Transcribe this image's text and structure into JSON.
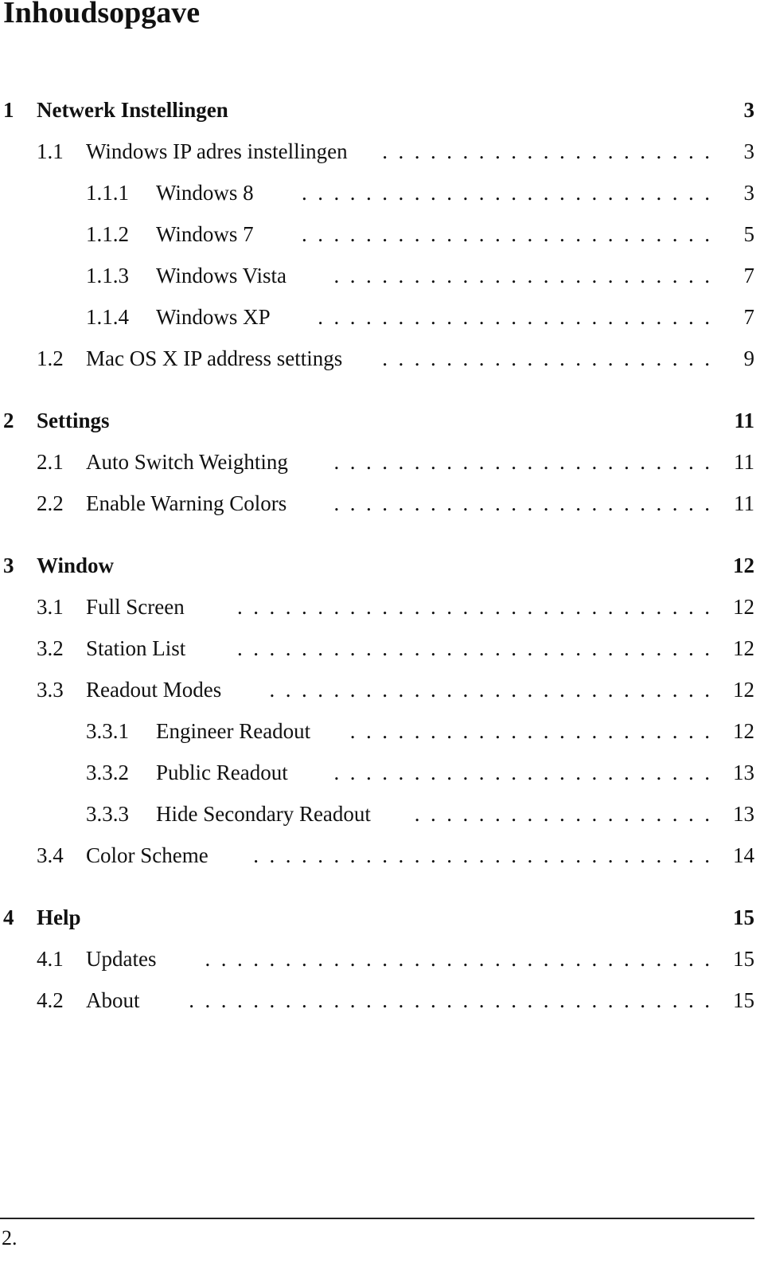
{
  "title": "Inhoudsopgave",
  "toc": [
    {
      "level": 0,
      "num": "1",
      "label": "Netwerk Instellingen",
      "page": "3",
      "gap": false
    },
    {
      "level": 1,
      "num": "1.1",
      "label": "Windows IP adres instellingen",
      "page": "3"
    },
    {
      "level": 2,
      "num": "1.1.1",
      "label": "Windows 8",
      "page": "3"
    },
    {
      "level": 2,
      "num": "1.1.2",
      "label": "Windows 7",
      "page": "5"
    },
    {
      "level": 2,
      "num": "1.1.3",
      "label": "Windows Vista",
      "page": "7"
    },
    {
      "level": 2,
      "num": "1.1.4",
      "label": "Windows XP",
      "page": "7"
    },
    {
      "level": 1,
      "num": "1.2",
      "label": "Mac OS X IP address settings",
      "page": "9"
    },
    {
      "level": 0,
      "num": "2",
      "label": "Settings",
      "page": "11",
      "gap": true
    },
    {
      "level": 1,
      "num": "2.1",
      "label": "Auto Switch Weighting",
      "page": "11"
    },
    {
      "level": 1,
      "num": "2.2",
      "label": "Enable Warning Colors",
      "page": "11"
    },
    {
      "level": 0,
      "num": "3",
      "label": "Window",
      "page": "12",
      "gap": true
    },
    {
      "level": 1,
      "num": "3.1",
      "label": "Full Screen",
      "page": "12"
    },
    {
      "level": 1,
      "num": "3.2",
      "label": "Station List",
      "page": "12"
    },
    {
      "level": 1,
      "num": "3.3",
      "label": "Readout Modes",
      "page": "12"
    },
    {
      "level": 2,
      "num": "3.3.1",
      "label": "Engineer Readout",
      "page": "12"
    },
    {
      "level": 2,
      "num": "3.3.2",
      "label": "Public Readout",
      "page": "13"
    },
    {
      "level": 2,
      "num": "3.3.3",
      "label": "Hide Secondary Readout",
      "page": "13"
    },
    {
      "level": 1,
      "num": "3.4",
      "label": "Color Scheme",
      "page": "14"
    },
    {
      "level": 0,
      "num": "4",
      "label": "Help",
      "page": "15",
      "gap": true
    },
    {
      "level": 1,
      "num": "4.1",
      "label": "Updates",
      "page": "15"
    },
    {
      "level": 1,
      "num": "4.2",
      "label": "About",
      "page": "15"
    }
  ],
  "footer": {
    "page_number": "2."
  }
}
